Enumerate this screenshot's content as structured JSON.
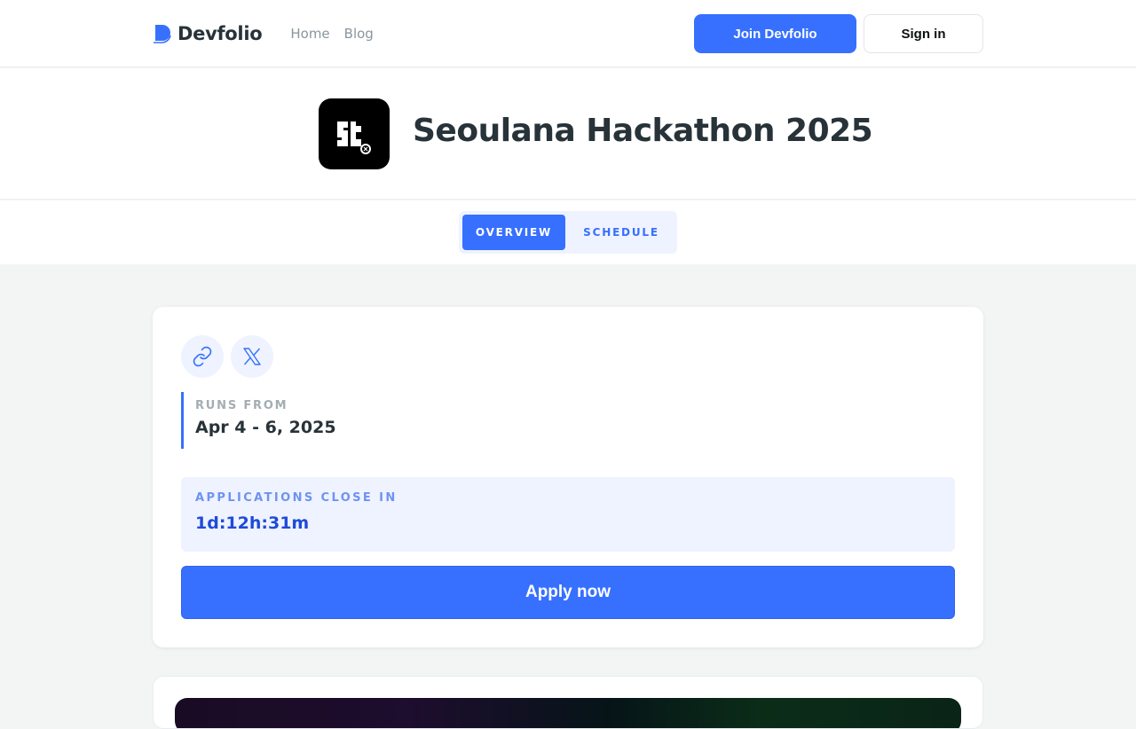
{
  "header": {
    "brand": "Devfolio",
    "nav": [
      {
        "label": "Home"
      },
      {
        "label": "Blog"
      }
    ],
    "join_label": "Join Devfolio",
    "signin_label": "Sign in"
  },
  "hero": {
    "title": "Seoulana Hackathon 2025"
  },
  "tabs": [
    {
      "label": "Overview",
      "active": true
    },
    {
      "label": "Schedule",
      "active": false
    }
  ],
  "card": {
    "socials": [
      {
        "icon": "link-icon"
      },
      {
        "icon": "x-twitter-icon"
      }
    ],
    "runs_from_label": "Runs from",
    "runs_from_value": "Apr 4 - 6, 2025",
    "applications_label": "Applications close in",
    "applications_value": "1d:12h:31m",
    "apply_label": "Apply now"
  },
  "colors": {
    "accent": "#3770ff",
    "accent_light": "#eef3ff",
    "text": "#273339",
    "page_bg": "#f3f5f4"
  }
}
